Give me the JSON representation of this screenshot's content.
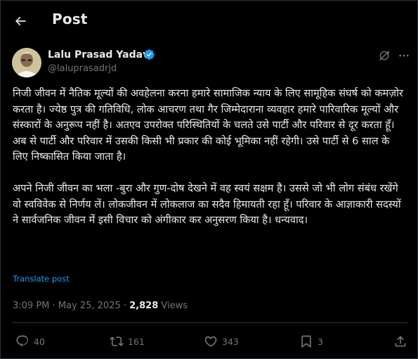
{
  "header": {
    "title": "Post",
    "back_icon": "arrow-left-icon"
  },
  "author": {
    "name": "Lalu Prasad Yadav",
    "handle": "@laluprasadrjd",
    "verified_color": "#1d9bf0",
    "verified_icon": "verified-badge-icon",
    "avatar_icon": "avatar-photo"
  },
  "post": {
    "paragraph_1": "निजी जीवन में नैतिक मूल्यों की अवहेलना करना हमारे सामाजिक न्याय के लिए सामूहिक संघर्ष को कमज़ोर करता है। ज्येष्ठ पुत्र की गतिविधि, लोक आचरण तथा गैर जिम्मेदाराना व्यवहार हमारे पारिवारिक मूल्यों और संस्कारों के अनुरूप नहीं है। अतएव उपरोक्त परिस्थितियों के चलते उसे पार्टी और परिवार से दूर करता हूँ। अब से पार्टी और परिवार में उसकी किसी भी प्रकार की कोई भूमिका नहीं रहेगी। उसे पार्टी से 6 साल के लिए निष्कासित किया जाता है।",
    "paragraph_2": "अपने निजी जीवन का भला -बुरा और गुण-दोष देखने में वह स्वयं सक्षम है। उससे जो भी लोग संबंध रखेंगे वो स्वविवेक से निर्णय लें। लोकजीवन में लोकलाज का सदैव हिमायती रहा हूँ। परिवार के आज्ञाकारी सदस्यों ने सार्वजनिक जीवन में इसी विचार को अंगीकार कर अनुसरण किया है। धन्यवाद।",
    "translate_label": "Translate post",
    "time": "3:09 PM",
    "separator": "·",
    "date": "May 25, 2025",
    "views_count": "2,828",
    "views_label": "Views"
  },
  "actions": {
    "replies": "40",
    "reposts": "161",
    "likes": "343",
    "bookmarks": "3"
  },
  "colors": {
    "background": "#000000",
    "text": "#e7e9ea",
    "muted": "#71767b",
    "accent": "#1d9bf0",
    "border": "#2f3336"
  }
}
